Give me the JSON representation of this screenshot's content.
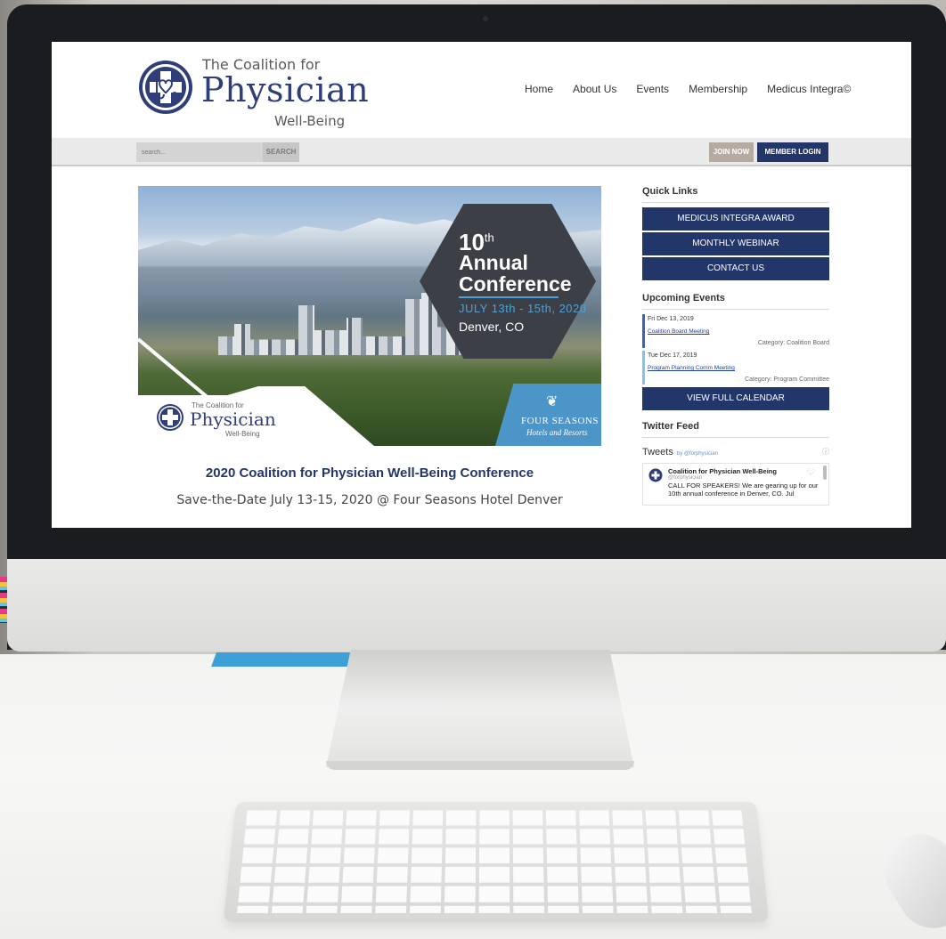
{
  "header": {
    "logo_small": "The Coalition for",
    "logo_big": "Physician",
    "logo_sub": "Well-Being",
    "nav": [
      "Home",
      "About Us",
      "Events",
      "Membership",
      "Medicus Integra©"
    ]
  },
  "toolbar": {
    "search_placeholder": "search...",
    "search_label": "SEARCH",
    "join_label": "JOIN NOW",
    "login_label": "MEMBER LOGIN"
  },
  "banner": {
    "number": "10",
    "number_sup": "th",
    "annual": "Annual",
    "conference": "Conference",
    "dates": "JULY 13th - 15th, 2020",
    "city": "Denver, CO",
    "logo_small": "The Coalition for",
    "logo_big": "Physician",
    "logo_sub": "Well-Being",
    "sponsor_name": "FOUR SEASONS",
    "sponsor_sub": "Hotels and Resorts"
  },
  "main": {
    "title": "2020 Coalition for Physician Well-Being Conference",
    "subtitle": "Save-the-Date July 13-15, 2020 @ Four Seasons Hotel Denver"
  },
  "sidebar": {
    "quick_links_heading": "Quick Links",
    "quick_links": [
      "MEDICUS INTEGRA AWARD",
      "MONTHLY WEBINAR",
      "CONTACT US"
    ],
    "events_heading": "Upcoming Events",
    "events": [
      {
        "date": "Fri Dec 13, 2019",
        "title": "Coalition Board Meeting",
        "category": "Category: Coalition Board"
      },
      {
        "date": "Tue Dec 17, 2019",
        "title": "Program Planning Comm Meeting",
        "category": "Category: Program Committee"
      }
    ],
    "calendar_label": "VIEW FULL CALENDAR",
    "twitter_heading": "Twitter Feed",
    "tweets_title": "Tweets",
    "tweets_by": "by @forphysician",
    "tweet": {
      "name": "Coalition for Physician Well-Being",
      "handle": "@forphysician",
      "text": "CALL FOR SPEAKERS! We are gearing up for our 10th annual conference in Denver, CO. Jul"
    }
  },
  "colors": {
    "brand_navy": "#22366a",
    "accent_blue": "#4aa0d8",
    "join_tan": "#b6aba1"
  },
  "icons": [
    "logo-cross-stethoscope-icon",
    "info-icon",
    "twitter-bird-icon",
    "leaf-icon"
  ]
}
